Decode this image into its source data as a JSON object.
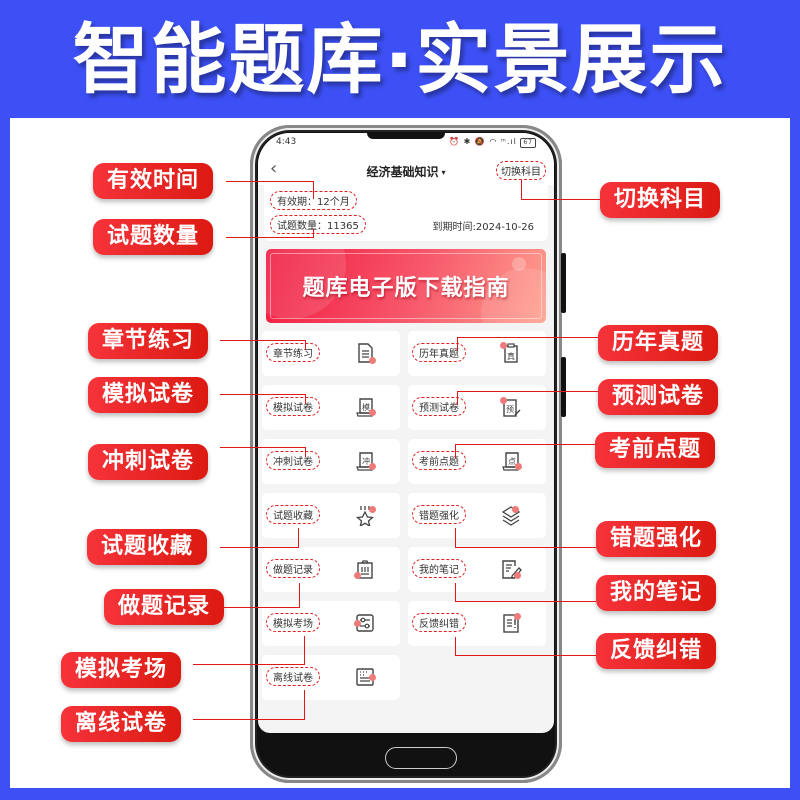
{
  "hero": {
    "title": "智能题库·实景展示"
  },
  "phone": {
    "status_bar": {
      "time": "4:43",
      "icons": "⏰ ✱ 🔕 ◠ ᵐ.ıl",
      "battery": "67"
    },
    "nav": {
      "back_icon": "‹",
      "title": "经济基础知识",
      "caret": "▾",
      "switch_label": "切换科目"
    },
    "info": {
      "validity": "有效期：12个月",
      "question_count": "试题数量：11365",
      "expire": "到期时间:2024-10-26"
    },
    "banner": {
      "text": "题库电子版下载指南"
    },
    "tiles": [
      {
        "label": "章节练习",
        "icon": "document-icon"
      },
      {
        "label": "历年真题",
        "icon": "clipboard-zhen-icon"
      },
      {
        "label": "模拟试卷",
        "icon": "scroll-mo-icon"
      },
      {
        "label": "预测试卷",
        "icon": "clipboard-yu-pen-icon"
      },
      {
        "label": "冲刺试卷",
        "icon": "scroll-chong-icon"
      },
      {
        "label": "考前点题",
        "icon": "scroll-dian-icon"
      },
      {
        "label": "试题收藏",
        "icon": "star-icon"
      },
      {
        "label": "错题强化",
        "icon": "layers-icon"
      },
      {
        "label": "做题记录",
        "icon": "clipboard-list-icon"
      },
      {
        "label": "我的笔记",
        "icon": "note-pencil-icon"
      },
      {
        "label": "模拟考场",
        "icon": "sliders-icon"
      },
      {
        "label": "反馈纠错",
        "icon": "feedback-icon"
      },
      {
        "label": "离线试卷",
        "icon": "offline-paper-icon"
      }
    ]
  },
  "callouts": {
    "left": [
      "有效时间",
      "试题数量",
      "章节练习",
      "模拟试卷",
      "冲刺试卷",
      "试题收藏",
      "做题记录",
      "模拟考场",
      "离线试卷"
    ],
    "right": [
      "切换科目",
      "历年真题",
      "预测试卷",
      "考前点题",
      "错题强化",
      "我的笔记",
      "反馈纠错"
    ]
  },
  "colors": {
    "background": "#3d50f5",
    "callout": "#e8221f",
    "accent_dashed": "#e02020",
    "banner_start": "#f0183e",
    "banner_end": "#ffa08f"
  }
}
